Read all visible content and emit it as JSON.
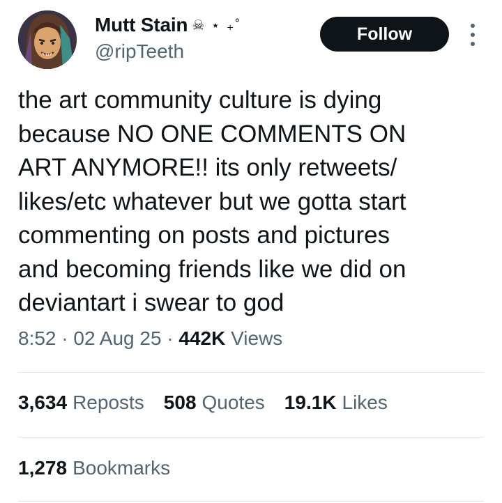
{
  "author": {
    "display_name": "Mutt Stain",
    "name_decoration": "☠ ⋆ ₊˚",
    "handle": "@ripTeeth",
    "avatar_icon": "character-portrait-avatar"
  },
  "follow_label": "Follow",
  "more_icon": "vertical-ellipsis-icon",
  "tweet": {
    "text": "the art community culture is dying\nbecause NO ONE COMMENTS ON\nART ANYMORE!! its only retweets/\nlikes/etc whatever but we gotta start\ncommenting on posts and pictures\nand becoming friends like we did on\ndeviantart i swear to god",
    "time": "8:52",
    "date": "02 Aug 25",
    "views_count": "442K",
    "views_label": "Views"
  },
  "stats": {
    "reposts": {
      "count": "3,634",
      "label": "Reposts"
    },
    "quotes": {
      "count": "508",
      "label": "Quotes"
    },
    "likes": {
      "count": "19.1K",
      "label": "Likes"
    },
    "bookmarks": {
      "count": "1,278",
      "label": "Bookmarks"
    }
  },
  "colors": {
    "text_primary": "#0f1419",
    "text_secondary": "#536471",
    "button_bg": "#0f1419",
    "divider": "#dfe3e6"
  }
}
